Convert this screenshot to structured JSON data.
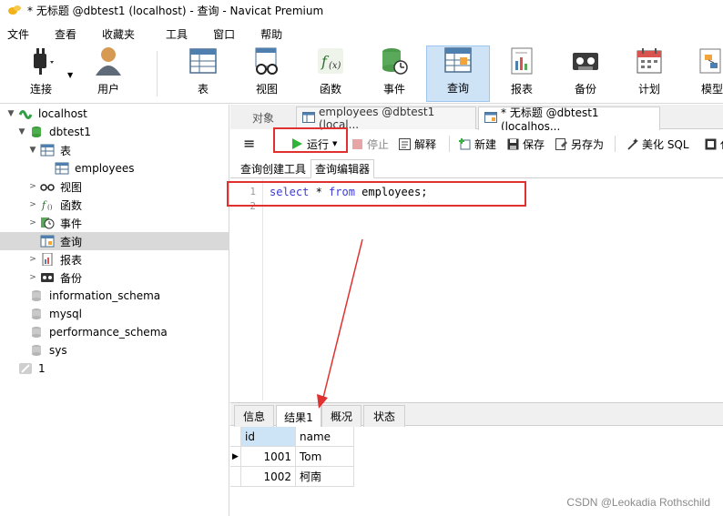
{
  "window": {
    "title": "* 无标题 @dbtest1 (localhost) - 查询 - Navicat Premium"
  },
  "menu": [
    "文件",
    "查看",
    "收藏夹",
    "工具",
    "窗口",
    "帮助"
  ],
  "ribbon": {
    "connect": "连接",
    "user": "用户",
    "table": "表",
    "view": "视图",
    "function": "函数",
    "event": "事件",
    "query": "查询",
    "report": "报表",
    "backup": "备份",
    "schedule": "计划",
    "model": "模型"
  },
  "sidebar": {
    "connection": "localhost",
    "database": "dbtest1",
    "tables_group": "表",
    "table_employees": "employees",
    "views": "视图",
    "functions": "函数",
    "events": "事件",
    "queries": "查询",
    "reports": "报表",
    "backups": "备份",
    "db_information_schema": "information_schema",
    "db_mysql": "mysql",
    "db_performance_schema": "performance_schema",
    "db_sys": "sys",
    "other_connection": "1"
  },
  "tabs": {
    "object": "对象",
    "employees_tab": "employees @dbtest1 (local...",
    "query_tab": "* 无标题 @dbtest1 (localhos..."
  },
  "query_toolbar": {
    "run": "运行",
    "stop": "停止",
    "explain": "解释",
    "new": "新建",
    "save": "保存",
    "save_as": "另存为",
    "beautify": "美化 SQL",
    "truncated": "代"
  },
  "subtabs": {
    "builder": "查询创建工具",
    "editor": "查询编辑器"
  },
  "editor": {
    "line1": "1",
    "line2": "2",
    "kw_select": "select",
    "star": " * ",
    "kw_from": "from",
    "rest": " employees;"
  },
  "result_tabs": {
    "info": "信息",
    "result1": "结果1",
    "profile": "概况",
    "status": "状态"
  },
  "grid": {
    "columns": [
      "id",
      "name"
    ],
    "rows": [
      {
        "id": "1001",
        "name": "Tom"
      },
      {
        "id": "1002",
        "name": "柯南"
      }
    ]
  },
  "watermark": "CSDN @Leokadia Rothschild"
}
